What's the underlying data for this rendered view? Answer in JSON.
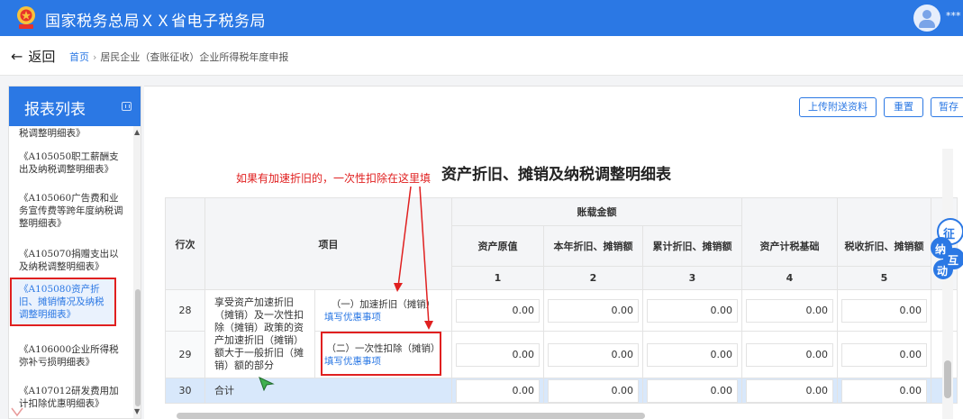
{
  "header": {
    "title": "国家税务总局ＸＸ省电子税务局",
    "user_name": "***",
    "brand_color": "#2b78e4"
  },
  "nav": {
    "back_label": "返回",
    "breadcrumb": {
      "home": "首页",
      "separator": "›",
      "current": "居民企业（查账征收）企业所得税年度申报"
    }
  },
  "sidebar": {
    "title": "报表列表",
    "items": [
      {
        "label": "税调整明细表》"
      },
      {
        "label": "《A105050职工薪酬支出及纳税调整明细表》"
      },
      {
        "label": "《A105060广告费和业务宣传费等跨年度纳税调整明细表》"
      },
      {
        "label": "《A105070捐赠支出以及纳税调整明细表》"
      },
      {
        "label": "《A105080资产折旧、摊销情况及纳税调整明细表》",
        "active": true
      },
      {
        "label": "《A106000企业所得税弥补亏损明细表》"
      },
      {
        "label": "《A107012研发费用加计扣除优惠明细表》"
      }
    ]
  },
  "toolbar": {
    "upload_label": "上传附送资料",
    "reset_label": "重置",
    "save_label": "暂存"
  },
  "form": {
    "title": "资产折旧、摊销及纳税调整明细表",
    "annotation": "如果有加速折旧的，一次性扣除在这里填",
    "headers": {
      "row_no": "行次",
      "item": "项目",
      "book_amount": "账载金额",
      "c1": "资产原值",
      "c2": "本年折旧、摊销额",
      "c3": "累计折旧、摊销额",
      "c4": "资产计税基础",
      "c5": "税收折旧、摊销额",
      "n1": "1",
      "n2": "2",
      "n3": "3",
      "n4": "4",
      "n5": "5"
    },
    "group_label": "享受资产加速折旧（摊销）及一次性扣除（摊销）政策的资产加速折旧（摊销）额大于一般折旧（摊销）额的部分",
    "rows": [
      {
        "no": "28",
        "sub": "（一）加速折旧（摊销）",
        "link": "填写优惠事项",
        "values": [
          "0.00",
          "0.00",
          "0.00",
          "0.00",
          "0.00"
        ]
      },
      {
        "no": "29",
        "sub": "（二）一次性扣除（摊销）",
        "link": "填写优惠事项",
        "values": [
          "0.00",
          "0.00",
          "0.00",
          "0.00",
          "0.00"
        ]
      },
      {
        "no": "30",
        "label": "合计",
        "values": [
          "0.00",
          "0.00",
          "0.00",
          "0.00",
          "0.00"
        ]
      }
    ]
  },
  "helper": {
    "chars": [
      "征",
      "纳",
      "互",
      "动"
    ]
  }
}
